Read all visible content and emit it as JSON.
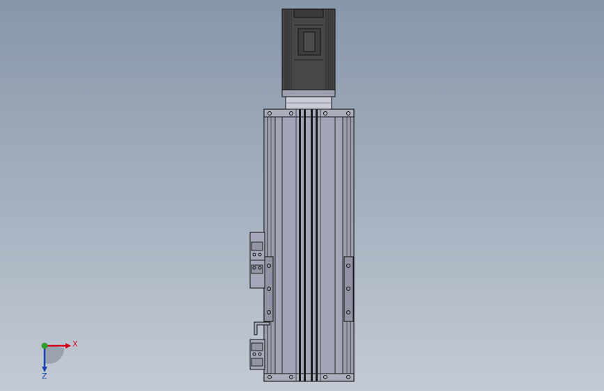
{
  "triad": {
    "x_label": "X",
    "z_label": "Z",
    "x_color": "#d0021b",
    "y_color": "#2e9e2e",
    "z_color": "#1c3fb0"
  },
  "model": {
    "motor_color": "#454545",
    "body_color": "#a2a6b6",
    "edge_color": "#1a1a1a",
    "bracket_color": "#8f93a3",
    "coupling_color": "#c9ccd6"
  }
}
